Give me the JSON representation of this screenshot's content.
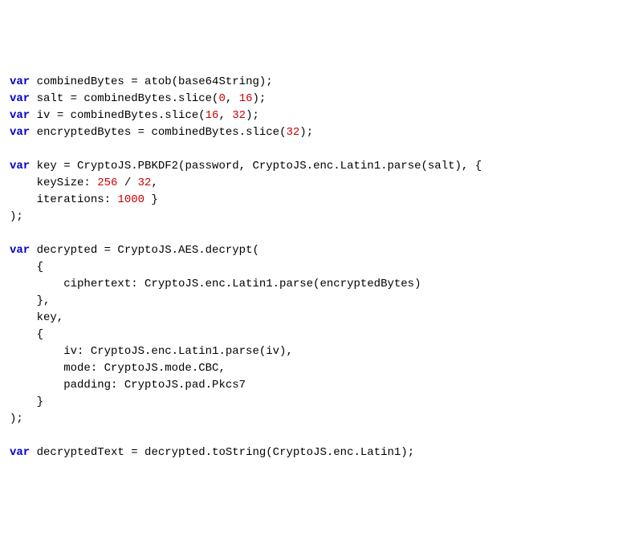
{
  "code": {
    "lines": [
      {
        "id": "l1",
        "tokens": [
          {
            "cls": "kw",
            "t": "var"
          },
          {
            "cls": "plain",
            "t": " combinedBytes = atob(base64String);"
          }
        ]
      },
      {
        "id": "l2",
        "tokens": [
          {
            "cls": "kw",
            "t": "var"
          },
          {
            "cls": "plain",
            "t": " salt = combinedBytes.slice("
          },
          {
            "cls": "num",
            "t": "0"
          },
          {
            "cls": "plain",
            "t": ", "
          },
          {
            "cls": "num",
            "t": "16"
          },
          {
            "cls": "plain",
            "t": ");"
          }
        ]
      },
      {
        "id": "l3",
        "tokens": [
          {
            "cls": "kw",
            "t": "var"
          },
          {
            "cls": "plain",
            "t": " iv = combinedBytes.slice("
          },
          {
            "cls": "num",
            "t": "16"
          },
          {
            "cls": "plain",
            "t": ", "
          },
          {
            "cls": "num",
            "t": "32"
          },
          {
            "cls": "plain",
            "t": ");"
          }
        ]
      },
      {
        "id": "l4",
        "tokens": [
          {
            "cls": "kw",
            "t": "var"
          },
          {
            "cls": "plain",
            "t": " encryptedBytes = combinedBytes.slice("
          },
          {
            "cls": "num",
            "t": "32"
          },
          {
            "cls": "plain",
            "t": ");"
          }
        ]
      },
      {
        "id": "l5",
        "tokens": []
      },
      {
        "id": "l6",
        "tokens": [
          {
            "cls": "kw",
            "t": "var"
          },
          {
            "cls": "plain",
            "t": " key = CryptoJS.PBKDF2(password, CryptoJS.enc.Latin1.parse(salt), {"
          }
        ]
      },
      {
        "id": "l7",
        "tokens": [
          {
            "cls": "plain",
            "t": "    keySize: "
          },
          {
            "cls": "num",
            "t": "256"
          },
          {
            "cls": "plain",
            "t": " / "
          },
          {
            "cls": "num",
            "t": "32"
          },
          {
            "cls": "plain",
            "t": ","
          }
        ]
      },
      {
        "id": "l8",
        "tokens": [
          {
            "cls": "plain",
            "t": "    iterations: "
          },
          {
            "cls": "num",
            "t": "1000"
          },
          {
            "cls": "plain",
            "t": " }"
          }
        ]
      },
      {
        "id": "l9",
        "tokens": [
          {
            "cls": "plain",
            "t": ");"
          }
        ]
      },
      {
        "id": "l10",
        "tokens": []
      },
      {
        "id": "l11",
        "tokens": [
          {
            "cls": "kw",
            "t": "var"
          },
          {
            "cls": "plain",
            "t": " decrypted = CryptoJS.AES.decrypt("
          }
        ]
      },
      {
        "id": "l12",
        "tokens": [
          {
            "cls": "plain",
            "t": "    {"
          }
        ]
      },
      {
        "id": "l13",
        "tokens": [
          {
            "cls": "plain",
            "t": "        ciphertext: CryptoJS.enc.Latin1.parse(encryptedBytes)"
          }
        ]
      },
      {
        "id": "l14",
        "tokens": [
          {
            "cls": "plain",
            "t": "    },"
          }
        ]
      },
      {
        "id": "l15",
        "tokens": [
          {
            "cls": "plain",
            "t": "    key,"
          }
        ]
      },
      {
        "id": "l16",
        "tokens": [
          {
            "cls": "plain",
            "t": "    {"
          }
        ]
      },
      {
        "id": "l17",
        "tokens": [
          {
            "cls": "plain",
            "t": "        iv: CryptoJS.enc.Latin1.parse(iv),"
          }
        ]
      },
      {
        "id": "l18",
        "tokens": [
          {
            "cls": "plain",
            "t": "        mode: CryptoJS.mode.CBC,"
          }
        ]
      },
      {
        "id": "l19",
        "tokens": [
          {
            "cls": "plain",
            "t": "        padding: CryptoJS.pad.Pkcs7"
          }
        ]
      },
      {
        "id": "l20",
        "tokens": [
          {
            "cls": "plain",
            "t": "    }"
          }
        ]
      },
      {
        "id": "l21",
        "tokens": [
          {
            "cls": "plain",
            "t": ");"
          }
        ]
      },
      {
        "id": "l22",
        "tokens": []
      },
      {
        "id": "l23",
        "tokens": [
          {
            "cls": "kw",
            "t": "var"
          },
          {
            "cls": "plain",
            "t": " decryptedText = decrypted.toString(CryptoJS.enc.Latin1);"
          }
        ]
      }
    ]
  }
}
